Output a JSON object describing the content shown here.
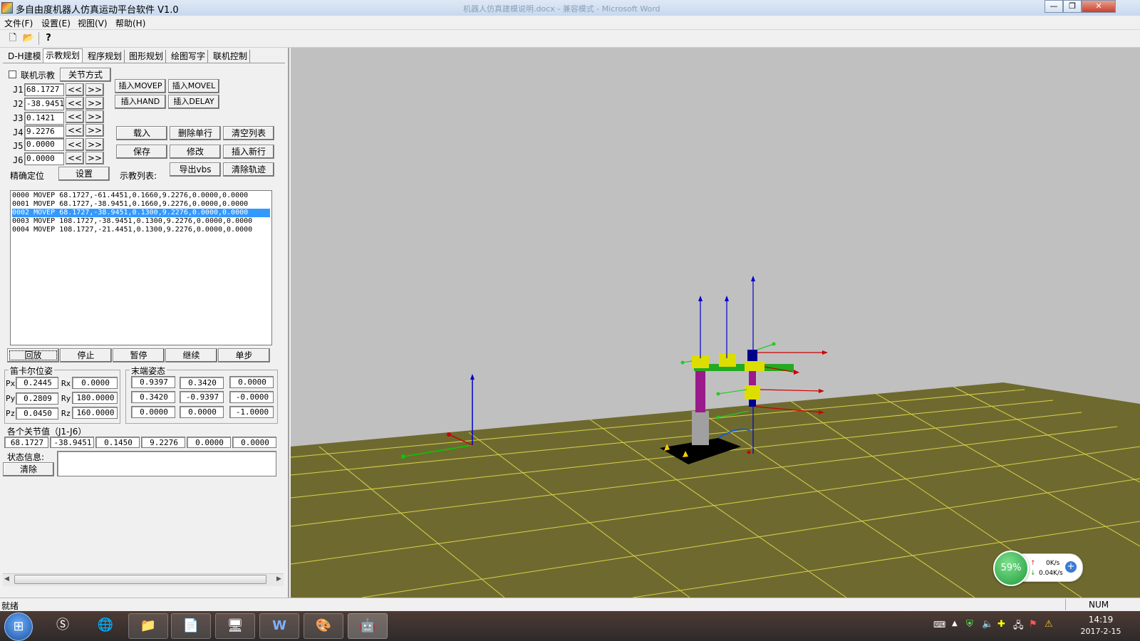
{
  "window": {
    "title": "多自由度机器人仿真运动平台软件 V1.0",
    "background_title": "机器人仿真建模说明.docx - 兼容模式 - Microsoft Word",
    "controls": {
      "minimize": "—",
      "restore": "❐",
      "close": "✕"
    }
  },
  "menu": [
    "文件(F)",
    "设置(E)",
    "视图(V)",
    "帮助(H)"
  ],
  "toolbar_icons": [
    "new-file-icon",
    "open-folder-icon",
    "help-icon"
  ],
  "tabs": [
    "D-H建模",
    "示教规划",
    "程序规划",
    "图形规划",
    "绘图写字",
    "联机控制"
  ],
  "active_tab": "示教规划",
  "teach": {
    "online_checkbox": "联机示教",
    "joint_mode_button": "关节方式",
    "joints": [
      {
        "label": "J1",
        "value": "68.1727"
      },
      {
        "label": "J2",
        "value": "-38.9451"
      },
      {
        "label": "J3",
        "value": "0.1421"
      },
      {
        "label": "J4",
        "value": "9.2276"
      },
      {
        "label": "J5",
        "value": "0.0000"
      },
      {
        "label": "J6",
        "value": "0.0000"
      }
    ],
    "dec_label": "<<",
    "inc_label": ">>",
    "insert_movep": "插入MOVEP",
    "insert_movel": "插入MOVEL",
    "insert_hand": "插入HAND",
    "insert_delay": "插入DELAY",
    "load": "载入",
    "delete_row": "删除单行",
    "clear_list": "清空列表",
    "save": "保存",
    "modify": "修改",
    "insert_row": "插入新行",
    "precise_label": "精确定位",
    "settings_button": "设置",
    "list_label": "示教列表:",
    "export_vbs": "导出vbs",
    "clear_track": "清除轨迹"
  },
  "teach_list": [
    "0000  MOVEP  68.1727,-61.4451,0.1660,9.2276,0.0000,0.0000",
    "0001  MOVEP  68.1727,-38.9451,0.1660,9.2276,0.0000,0.0000",
    "0002  MOVEP  68.1727,-38.9451,0.1300,9.2276,0.0000,0.0000",
    "0003  MOVEP  108.1727,-38.9451,0.1300,9.2276,0.0000,0.0000",
    "0004  MOVEP  108.1727,-21.4451,0.1300,9.2276,0.0000,0.0000"
  ],
  "selected_row": 2,
  "playback": [
    "回放",
    "停止",
    "暂停",
    "继续",
    "单步"
  ],
  "cartesian": {
    "title": "笛卡尔位姿",
    "px_label": "Px",
    "px": "0.2445",
    "rx_label": "Rx",
    "rx": "0.0000",
    "py_label": "Py",
    "py": "0.2809",
    "ry_label": "Ry",
    "ry": "180.0000",
    "pz_label": "Pz",
    "pz": "0.0450",
    "rz_label": "Rz",
    "rz": "160.0000"
  },
  "end_pose": {
    "title": "末端姿态",
    "matrix": [
      [
        "0.9397",
        "0.3420",
        "0.0000"
      ],
      [
        "0.3420",
        "-0.9397",
        "-0.0000"
      ],
      [
        "0.0000",
        "0.0000",
        "-1.0000"
      ]
    ]
  },
  "joint_values": {
    "title": "各个关节值（J1-J6）",
    "values": [
      "68.1727",
      "-38.9451",
      "0.1450",
      "9.2276",
      "0.0000",
      "0.0000"
    ]
  },
  "status": {
    "label": "状态信息:",
    "clear": "清除",
    "text": ""
  },
  "statusbar": {
    "left": "就绪",
    "num": "NUM"
  },
  "clock": {
    "time": "14:19",
    "date": "2017-2-15"
  },
  "network_widget": {
    "percent": "59%",
    "up": "0K/s",
    "down": "0.04K/s"
  },
  "taskbar_apps": [
    "start-orb-icon",
    "sogou-icon",
    "ie-icon",
    "folder-icon",
    "pdf-icon",
    "monitor-icon",
    "word-icon",
    "palette-icon",
    "robot-app-icon"
  ],
  "colors": {
    "floor": "#6e6a2f",
    "grid": "#d8d24a",
    "viewport_bg": "#c0c0c0",
    "selection": "#3399ff"
  }
}
